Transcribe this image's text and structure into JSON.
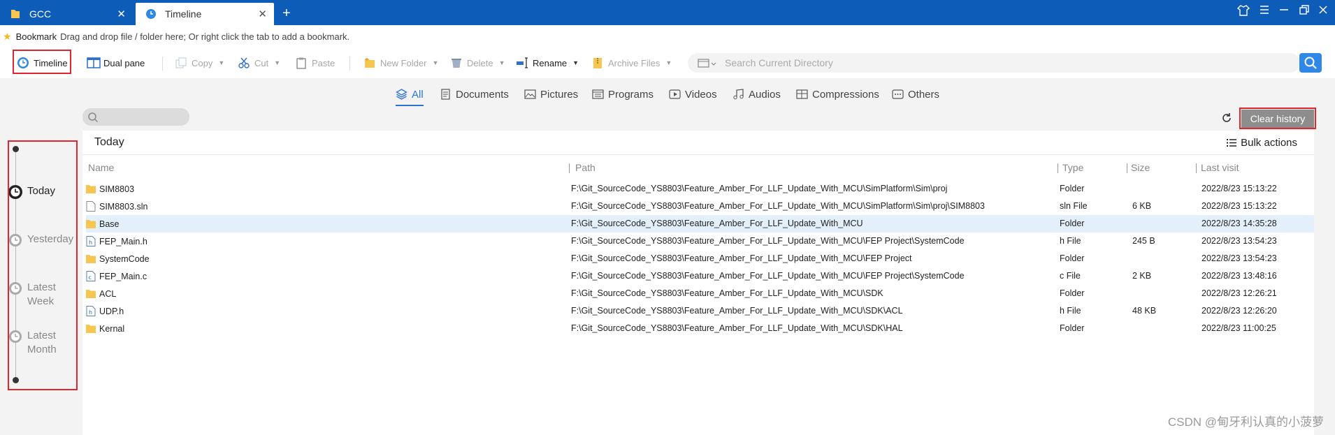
{
  "tabs": [
    {
      "label": "GCC",
      "icon": "folder-icon",
      "active": false
    },
    {
      "label": "Timeline",
      "icon": "timeline-icon",
      "active": true
    }
  ],
  "bookmark": {
    "label": "Bookmark",
    "hint": "Drag and drop file / folder here; Or right click the tab to add a bookmark."
  },
  "toolbar": {
    "timeline": "Timeline",
    "dual_pane": "Dual pane",
    "copy": "Copy",
    "cut": "Cut",
    "paste": "Paste",
    "new_folder": "New Folder",
    "delete": "Delete",
    "rename": "Rename",
    "archive_files": "Archive Files",
    "search_placeholder": "Search Current Directory"
  },
  "categories": [
    "All",
    "Documents",
    "Pictures",
    "Programs",
    "Videos",
    "Audios",
    "Compressions",
    "Others"
  ],
  "timeline": {
    "items": [
      {
        "label": "Today",
        "active": true
      },
      {
        "label": "Yesterday",
        "active": false
      },
      {
        "label": "Latest Week",
        "active": false
      },
      {
        "label": "Latest Month",
        "active": false
      }
    ]
  },
  "actions": {
    "clear_history": "Clear history",
    "bulk_actions": "Bulk actions"
  },
  "section_title": "Today",
  "columns": {
    "name": "Name",
    "path": "Path",
    "type": "Type",
    "size": "Size",
    "last_visit": "Last visit"
  },
  "rows": [
    {
      "name": "SIM8803",
      "icon": "folder-icon",
      "path": "F:\\Git_SourceCode_YS8803\\Feature_Amber_For_LLF_Update_With_MCU\\SimPlatform\\Sim\\proj",
      "type": "Folder",
      "size": "",
      "visit": "2022/8/23 15:13:22"
    },
    {
      "name": "SIM8803.sln",
      "icon": "file-icon",
      "path": "F:\\Git_SourceCode_YS8803\\Feature_Amber_For_LLF_Update_With_MCU\\SimPlatform\\Sim\\proj\\SIM8803",
      "type": "sln File",
      "size": "6 KB",
      "visit": "2022/8/23 15:13:22"
    },
    {
      "name": "Base",
      "icon": "folder-icon",
      "path": "F:\\Git_SourceCode_YS8803\\Feature_Amber_For_LLF_Update_With_MCU",
      "type": "Folder",
      "size": "",
      "visit": "2022/8/23 14:35:28"
    },
    {
      "name": "FEP_Main.h",
      "icon": "h-file-icon",
      "path": "F:\\Git_SourceCode_YS8803\\Feature_Amber_For_LLF_Update_With_MCU\\FEP Project\\SystemCode",
      "type": "h File",
      "size": "245 B",
      "visit": "2022/8/23 13:54:23"
    },
    {
      "name": "SystemCode",
      "icon": "folder-icon",
      "path": "F:\\Git_SourceCode_YS8803\\Feature_Amber_For_LLF_Update_With_MCU\\FEP Project",
      "type": "Folder",
      "size": "",
      "visit": "2022/8/23 13:54:23"
    },
    {
      "name": "FEP_Main.c",
      "icon": "c-file-icon",
      "path": "F:\\Git_SourceCode_YS8803\\Feature_Amber_For_LLF_Update_With_MCU\\FEP Project\\SystemCode",
      "type": "c File",
      "size": "2 KB",
      "visit": "2022/8/23 13:48:16"
    },
    {
      "name": "ACL",
      "icon": "folder-icon",
      "path": "F:\\Git_SourceCode_YS8803\\Feature_Amber_For_LLF_Update_With_MCU\\SDK",
      "type": "Folder",
      "size": "",
      "visit": "2022/8/23 12:26:21"
    },
    {
      "name": "UDP.h",
      "icon": "h-file-icon",
      "path": "F:\\Git_SourceCode_YS8803\\Feature_Amber_For_LLF_Update_With_MCU\\SDK\\ACL",
      "type": "h File",
      "size": "48 KB",
      "visit": "2022/8/23 12:26:20"
    },
    {
      "name": "Kernal",
      "icon": "folder-icon",
      "path": "F:\\Git_SourceCode_YS8803\\Feature_Amber_For_LLF_Update_With_MCU\\SDK\\HAL",
      "type": "Folder",
      "size": "",
      "visit": "2022/8/23 11:00:25"
    }
  ],
  "watermark": "CSDN @甸牙利认真的小菠萝",
  "colors": {
    "titlebar": "#0d5db8",
    "accent": "#2a73d8",
    "highlight_row": "#e3f0fb",
    "annotation_box": "#e0262c",
    "folder": "#f6c651"
  }
}
